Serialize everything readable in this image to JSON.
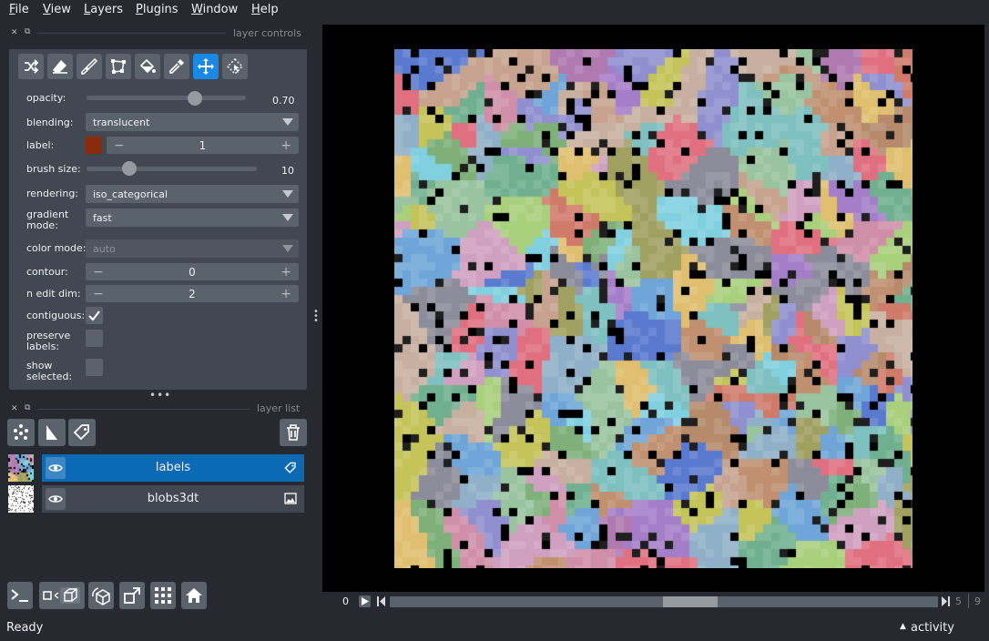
{
  "menu": {
    "items": [
      {
        "label": "File",
        "u": "F",
        "rest": "ile"
      },
      {
        "label": "View",
        "u": "V",
        "rest": "iew"
      },
      {
        "label": "Layers",
        "u": "L",
        "rest": "ayers"
      },
      {
        "label": "Plugins",
        "u": "P",
        "rest": "lugins"
      },
      {
        "label": "Window",
        "u": "W",
        "rest": "indow"
      },
      {
        "label": "Help",
        "u": "H",
        "rest": "elp"
      }
    ]
  },
  "layer_controls": {
    "title": "layer controls",
    "tools": [
      "shuffle-icon",
      "eraser-icon",
      "paintbrush-icon",
      "polygon-icon",
      "fill-bucket-icon",
      "color-picker-icon",
      "pan-zoom-icon",
      "transform-icon"
    ],
    "active_tool": "pan-zoom-icon",
    "opacity_label": "opacity:",
    "opacity_value": "0.70",
    "opacity_fraction": 0.7,
    "blending_label": "blending:",
    "blending_value": "translucent",
    "label_label": "label:",
    "label_value": "1",
    "label_color": "#8a2b0b",
    "brush_size_label": "brush size:",
    "brush_size_value": "10",
    "rendering_label": "rendering:",
    "rendering_value": "iso_categorical",
    "gradient_label_1": "gradient",
    "gradient_label_2": "mode:",
    "gradient_value": "fast",
    "color_mode_label": "color mode:",
    "color_mode_value": "auto",
    "contour_label": "contour:",
    "contour_value": "0",
    "n_edit_dim_label": "n edit dim:",
    "n_edit_dim_value": "2",
    "contiguous_label": "contiguous:",
    "contiguous_checked": true,
    "preserve_label_1": "preserve",
    "preserve_label_2": "labels:",
    "preserve_checked": false,
    "show_selected_label_1": "show",
    "show_selected_label_2": "selected:",
    "show_selected_checked": false
  },
  "layer_list": {
    "title": "layer list",
    "layers": [
      {
        "name": "labels",
        "type_icon": "label-tag-icon",
        "selected": true
      },
      {
        "name": "blobs3dt",
        "type_icon": "image-icon",
        "selected": false
      }
    ]
  },
  "dims": {
    "current": "0",
    "mid_value": "5",
    "max_value": "9"
  },
  "status": {
    "text": "Ready",
    "activity_label": "activity"
  },
  "colors": {
    "accent": "#1a89e6",
    "selected_layer": "#0b6ab3",
    "panel": "#414851",
    "background": "#262930"
  }
}
